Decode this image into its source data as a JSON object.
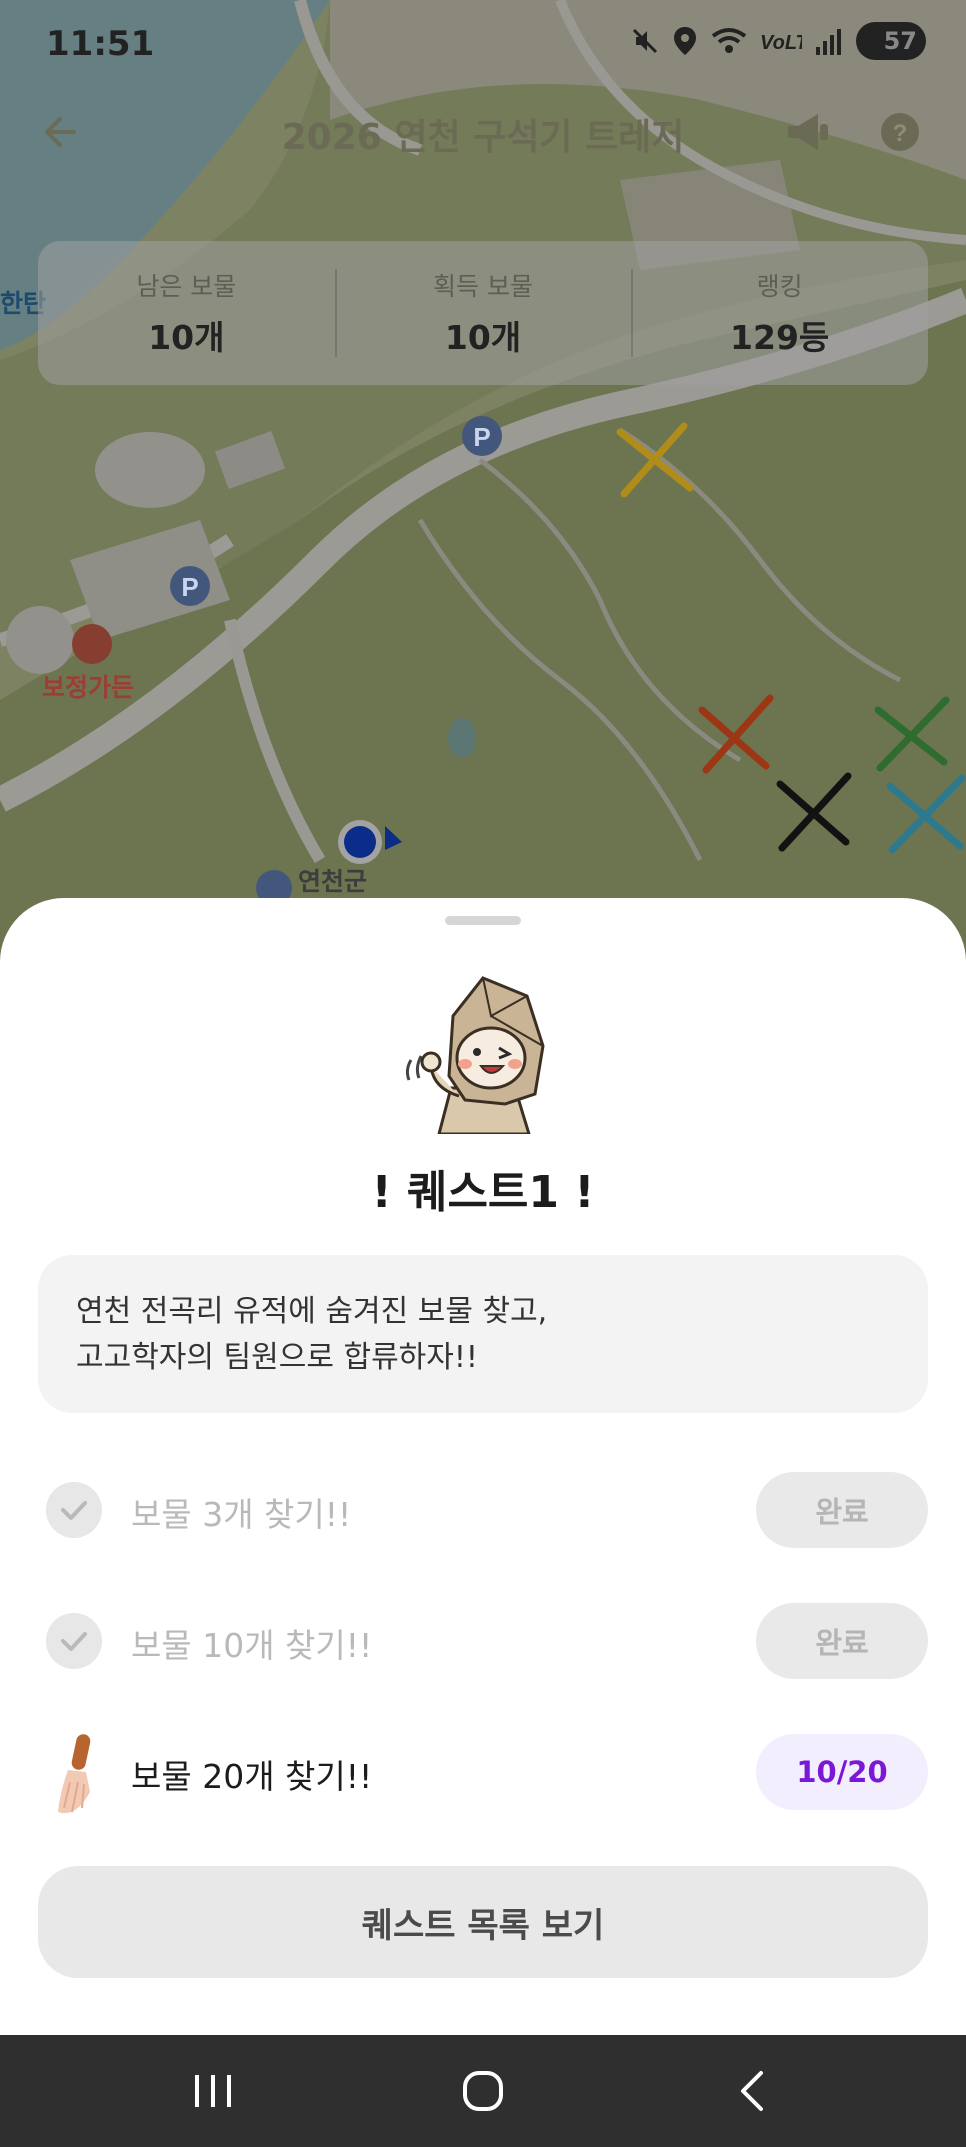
{
  "status": {
    "time": "11:51",
    "battery": "57"
  },
  "header": {
    "title": "2026 연천 구석기 트레저"
  },
  "stats": [
    {
      "label": "남은 보물",
      "value": "10개"
    },
    {
      "label": "획득 보물",
      "value": "10개"
    },
    {
      "label": "랭킹",
      "value": "129등"
    }
  ],
  "map": {
    "labels": {
      "garden": "보정가든",
      "county": "연천군",
      "left_edge": "한탄"
    },
    "marker_colors": [
      "#d4a418",
      "#c94417",
      "#3d8b3d",
      "#1e1e1e",
      "#3a8fa8"
    ]
  },
  "quest": {
    "title": "! 퀘스트1 !",
    "description_lines": [
      "연천 전곡리 유적에 숨겨진 보물 찾고,",
      "고고학자의 팀원으로 합류하자!!"
    ],
    "tasks": [
      {
        "label": "보물 3개 찾기!!",
        "status": "완료"
      },
      {
        "label": "보물 10개 찾기!!",
        "status": "완료"
      },
      {
        "label": "보물 20개 찾기!!",
        "status": "10/20"
      }
    ],
    "list_button": "퀘스트 목록 보기"
  },
  "colors": {
    "accent_purple": "#7b18d6",
    "accent_bg": "#f3eefe"
  }
}
